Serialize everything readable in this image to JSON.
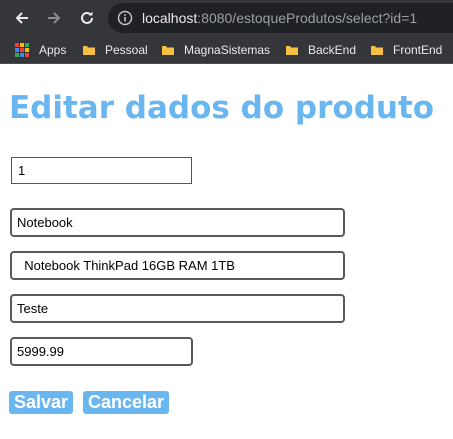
{
  "browser": {
    "url_host": "localhost",
    "url_rest": ":8080/estoqueProdutos/select?id=1",
    "bookmarks": [
      "Apps",
      "Pessoal",
      "MagnaSistemas",
      "BackEnd",
      "FrontEnd"
    ]
  },
  "page": {
    "title": "Editar dados do produto",
    "fields": {
      "id": "1",
      "name": "Notebook",
      "description": "  Notebook ThinkPad 16GB RAM 1TB",
      "category": "Teste",
      "price": "5999.99"
    },
    "buttons": {
      "save": "Salvar",
      "cancel": "Cancelar"
    }
  },
  "colors": {
    "accent": "#6ab6f0",
    "chrome_bg": "#35363a",
    "id_field_border": "#cc2222",
    "folder_icon": "#f6c044"
  }
}
